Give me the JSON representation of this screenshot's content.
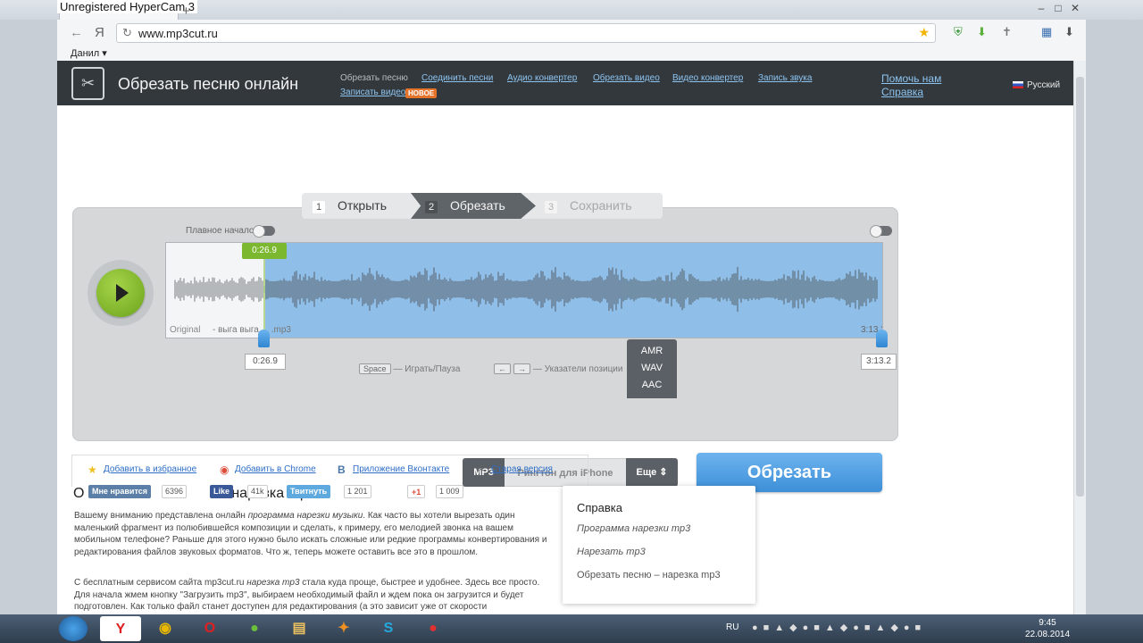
{
  "recorder_watermark": "Unregistered HyperCam 3",
  "browser": {
    "url": "www.mp3cut.ru",
    "user_menu": "Данил ▾",
    "new_tab": "+"
  },
  "header": {
    "title": "Обрезать песню онлайн",
    "nav": [
      "Обрезать песню",
      "Соединить песни",
      "Аудио конвертер",
      "Обрезать видео",
      "Видео конвертер",
      "Запись звука",
      "Записать видео"
    ],
    "new_badge": "НОВОЕ",
    "help_us": "Помочь нам",
    "help": "Справка",
    "language": "Русский"
  },
  "steps": [
    {
      "num": "1",
      "label": "Открыть"
    },
    {
      "num": "2",
      "label": "Обрезать"
    },
    {
      "num": "3",
      "label": "Сохранить"
    }
  ],
  "editor": {
    "smooth_start": "Плавное начало",
    "marker_time": "0:26.9",
    "original_label": "Original",
    "file_name": "- выга выга ... .mp3",
    "end_time_label": "3:13.2",
    "start_box": "0:26.9",
    "end_box": "3:13.2",
    "space_key": "Space",
    "space_hint": "— Играть/Пауза",
    "arrow_left": "←",
    "arrow_right": "→",
    "arrows_hint": "— Указатели позиции"
  },
  "formats": {
    "mp3": "MP3",
    "ringtone": "Рингтон для iPhone",
    "more": "Еще ⇕",
    "dropdown": [
      "AMR",
      "WAV",
      "AAC"
    ]
  },
  "cut_button": "Обрезать",
  "links": [
    "Добавить в избранное",
    "Добавить в Chrome",
    "Приложение Вконтакте",
    "Старая версия"
  ],
  "heading_start": "О",
  "heading_end": "– нарезка mp3",
  "social": {
    "vk_label": "Мне нравится",
    "vk_count": "6396",
    "fb_label": "Like",
    "fb_count": "41k",
    "tw_label": "Твитнуть",
    "tw_count": "1 201",
    "gp_label": "+1",
    "gp_count": "1 009"
  },
  "paragraph1": {
    "pre": "Вашему вниманию представлена онлайн ",
    "em": "программа нарезки музыки",
    "post": ". Как часто вы хотели вырезать один маленький фрагмент из полюбившейся композиции и сделать, к примеру, его мелодией звонка на вашем мобильном телефоне? Раньше для этого нужно было искать сложные или редкие программы конвертирования и редактирования файлов звуковых форматов. Что ж, теперь можете оставить все это в прошлом."
  },
  "paragraph2": {
    "pre": "С бесплатным сервисом сайта mp3cut.ru ",
    "em": "нарезка mp3",
    "post": " стала куда проще, быстрее и удобнее. Здесь все просто. Для начала жмем кнопку \"Загрузить mp3\", выбираем необходимый файл и ждем пока он загрузится и будет подготовлен. Как только файл станет доступен для редактирования (а это зависит уже от скорости"
  },
  "help_panel": {
    "title": "Справка",
    "items": [
      "Программа нарезки mp3",
      "Нарезать mp3",
      "Обрезать песню – нарезка mp3"
    ]
  },
  "taskbar": {
    "lang": "RU",
    "time": "9:45",
    "date": "22.08.2014"
  },
  "colors": {
    "accent": "#3d8fd8",
    "header_bg": "#33383d",
    "play_green": "#7cb82f",
    "badge": "#e4732b"
  }
}
